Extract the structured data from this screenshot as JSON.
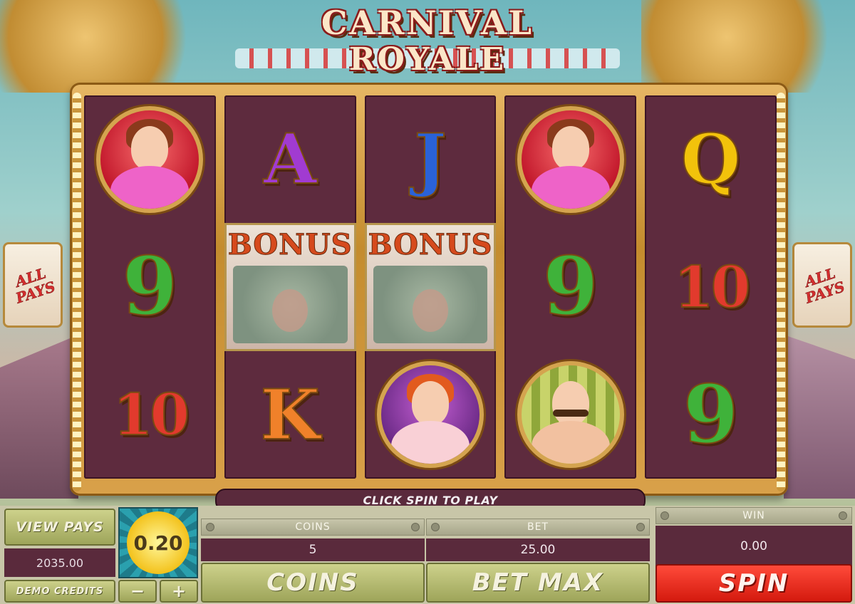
{
  "title": {
    "line1": "CARNIVAL",
    "line2": "ROYALE"
  },
  "badges": {
    "all_pays": "ALL\nPAYS"
  },
  "reels": [
    [
      {
        "kind": "portrait",
        "figure": "lady"
      },
      {
        "kind": "text",
        "sym": "9",
        "text": "9"
      },
      {
        "kind": "text",
        "sym": "10",
        "text": "10"
      }
    ],
    [
      {
        "kind": "text",
        "sym": "A",
        "text": "A"
      },
      {
        "kind": "bonus",
        "text": "BONUS"
      },
      {
        "kind": "text",
        "sym": "K",
        "text": "K"
      }
    ],
    [
      {
        "kind": "text",
        "sym": "J",
        "text": "J"
      },
      {
        "kind": "bonus",
        "text": "BONUS"
      },
      {
        "kind": "portrait",
        "figure": "clown"
      }
    ],
    [
      {
        "kind": "portrait",
        "figure": "lady"
      },
      {
        "kind": "text",
        "sym": "9",
        "text": "9"
      },
      {
        "kind": "portrait",
        "figure": "strongman"
      }
    ],
    [
      {
        "kind": "text",
        "sym": "Q",
        "text": "Q"
      },
      {
        "kind": "text",
        "sym": "10",
        "text": "10"
      },
      {
        "kind": "text",
        "sym": "9",
        "text": "9"
      }
    ]
  ],
  "message": "CLICK SPIN TO PLAY",
  "panel": {
    "view_pays": "VIEW PAYS",
    "balance": "2035.00",
    "demo_credits": "DEMO CREDITS",
    "coin_value": "0.20",
    "minus": "−",
    "plus": "+",
    "coins_label": "COINS",
    "coins_value": "5",
    "bet_label": "BET",
    "bet_value": "25.00",
    "win_label": "WIN",
    "win_value": "0.00",
    "coins_button": "COINS",
    "bet_max_button": "BET MAX",
    "spin_button": "SPIN"
  }
}
